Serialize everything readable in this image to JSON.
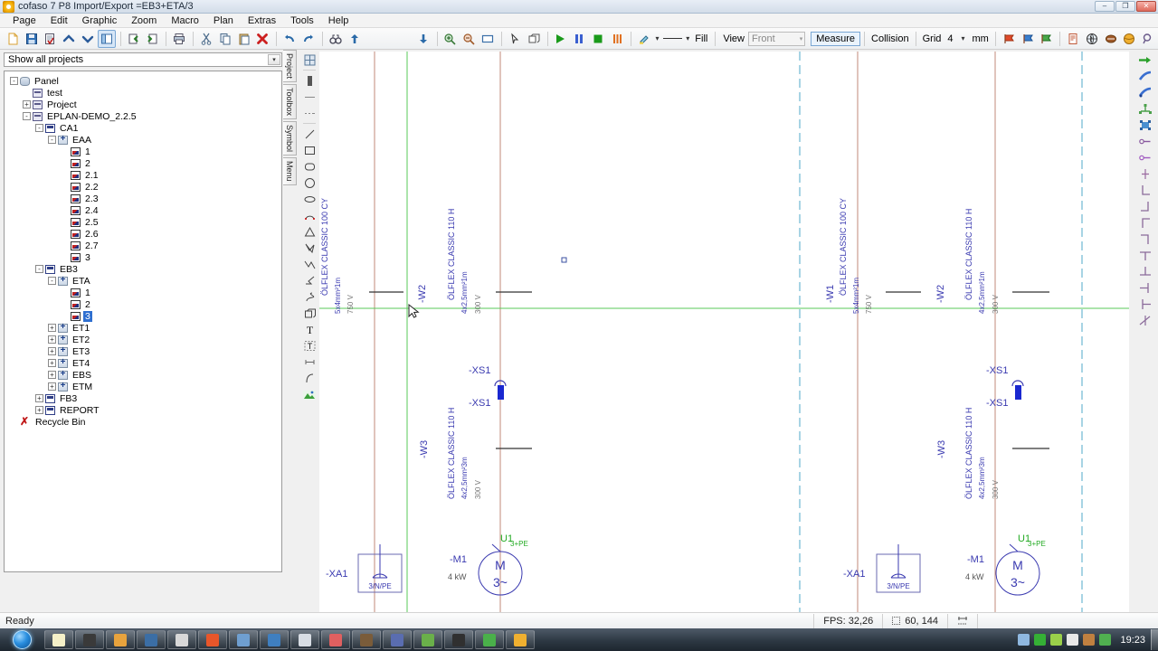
{
  "window": {
    "title": "cofaso 7 P8 Import/Export =EB3+ETA/3",
    "app_icon": "cofaso-icon",
    "minimize": "–",
    "maximize": "❐",
    "close": "✕"
  },
  "menu": {
    "items": [
      "Page",
      "Edit",
      "Graphic",
      "Zoom",
      "Macro",
      "Plan",
      "Extras",
      "Tools",
      "Help"
    ]
  },
  "main_toolbar": {
    "buttons": [
      {
        "name": "new-document-button",
        "icon": "new-page-icon"
      },
      {
        "name": "save-button",
        "icon": "floppy-disk-icon"
      },
      {
        "name": "save-as-button",
        "icon": "document-check-icon"
      },
      {
        "name": "page-up-button",
        "icon": "chevron-up-icon"
      },
      {
        "name": "page-down-button",
        "icon": "chevron-down-icon"
      },
      {
        "name": "toggle-panel-button",
        "icon": "split-panel-icon"
      },
      {
        "name": "import-button",
        "icon": "import-arrow-icon"
      },
      {
        "name": "export-button",
        "icon": "export-arrow-icon"
      },
      {
        "name": "print-button",
        "icon": "printer-icon"
      },
      {
        "name": "cut-button",
        "icon": "scissors-icon"
      },
      {
        "name": "copy-button",
        "icon": "copy-icon"
      },
      {
        "name": "paste-button",
        "icon": "clipboard-paste-icon"
      },
      {
        "name": "delete-button",
        "icon": "red-x-icon"
      },
      {
        "name": "undo-button",
        "icon": "undo-arrow-icon"
      },
      {
        "name": "redo-button",
        "icon": "redo-arrow-icon"
      },
      {
        "name": "find-button",
        "icon": "binoculars-icon"
      },
      {
        "name": "upload-button",
        "icon": "blue-up-arrow-icon"
      }
    ]
  },
  "view_toolbar": {
    "buttons": [
      {
        "name": "down-arrow-button",
        "icon": "blue-down-arrow-icon"
      },
      {
        "name": "zoom-in-button",
        "icon": "magnifier-plus-icon"
      },
      {
        "name": "zoom-out-button",
        "icon": "magnifier-minus-icon"
      },
      {
        "name": "zoom-window-button",
        "icon": "rectangle-icon"
      },
      {
        "name": "select-tool-button",
        "icon": "cursor-arrow-icon"
      },
      {
        "name": "box-tool-button",
        "icon": "cube-icon"
      },
      {
        "name": "play-button",
        "icon": "green-play-icon"
      },
      {
        "name": "pause-button",
        "icon": "blue-pause-icon"
      },
      {
        "name": "stop-button",
        "icon": "green-stop-icon"
      },
      {
        "name": "render-button",
        "icon": "orange-bars-icon"
      },
      {
        "name": "paint-button",
        "icon": "paintbrush-icon"
      },
      {
        "name": "line-style-button",
        "icon": "line-icon"
      }
    ],
    "fill_label": "Fill",
    "view_label": "View",
    "view_value": "Front",
    "measure_label": "Measure",
    "collision_label": "Collision",
    "grid_label": "Grid",
    "grid_value": "4",
    "unit_label": "mm",
    "flag_buttons": [
      {
        "name": "flag-red-button",
        "icon": "red-flag-icon"
      },
      {
        "name": "flag-blue-button",
        "icon": "blue-flag-icon"
      },
      {
        "name": "flag-green-button",
        "icon": "green-flag-icon"
      }
    ],
    "extra_buttons": [
      {
        "name": "report-button",
        "icon": "report-document-icon"
      },
      {
        "name": "globe-button",
        "icon": "globe-icon"
      },
      {
        "name": "ball-button",
        "icon": "brown-ball-icon"
      },
      {
        "name": "sphere-button",
        "icon": "orange-sphere-icon"
      },
      {
        "name": "search-button",
        "icon": "magnifier-icon"
      }
    ]
  },
  "sidebar": {
    "project_filter": "Show all projects",
    "tabs": [
      "Project",
      "Toolbox",
      "Symbol",
      "Menu"
    ],
    "tree": [
      {
        "label": "Panel",
        "indent": 0,
        "expander": "-",
        "icon": "panel-icon",
        "selected": false
      },
      {
        "label": "test",
        "indent": 1,
        "expander": "",
        "icon": "book-icon",
        "selected": false
      },
      {
        "label": "Project",
        "indent": 1,
        "expander": "+",
        "icon": "book-icon",
        "selected": false
      },
      {
        "label": "EPLAN-DEMO_2.2.5",
        "indent": 1,
        "expander": "-",
        "icon": "book-icon",
        "selected": false
      },
      {
        "label": "CA1",
        "indent": 2,
        "expander": "-",
        "icon": "page-icon",
        "selected": false
      },
      {
        "label": "EAA",
        "indent": 3,
        "expander": "-",
        "icon": "plus-icon",
        "selected": false
      },
      {
        "label": "1",
        "indent": 4,
        "expander": "",
        "icon": "sheet-icon",
        "selected": false
      },
      {
        "label": "2",
        "indent": 4,
        "expander": "",
        "icon": "sheet-icon",
        "selected": false
      },
      {
        "label": "2.1",
        "indent": 4,
        "expander": "",
        "icon": "sheet-icon",
        "selected": false
      },
      {
        "label": "2.2",
        "indent": 4,
        "expander": "",
        "icon": "sheet-icon",
        "selected": false
      },
      {
        "label": "2.3",
        "indent": 4,
        "expander": "",
        "icon": "sheet-icon",
        "selected": false
      },
      {
        "label": "2.4",
        "indent": 4,
        "expander": "",
        "icon": "sheet-icon",
        "selected": false
      },
      {
        "label": "2.5",
        "indent": 4,
        "expander": "",
        "icon": "sheet-icon",
        "selected": false
      },
      {
        "label": "2.6",
        "indent": 4,
        "expander": "",
        "icon": "sheet-icon",
        "selected": false
      },
      {
        "label": "2.7",
        "indent": 4,
        "expander": "",
        "icon": "sheet-icon",
        "selected": false
      },
      {
        "label": "3",
        "indent": 4,
        "expander": "",
        "icon": "sheet-icon",
        "selected": false
      },
      {
        "label": "EB3",
        "indent": 2,
        "expander": "-",
        "icon": "page-icon",
        "selected": false
      },
      {
        "label": "ETA",
        "indent": 3,
        "expander": "-",
        "icon": "plus-icon",
        "selected": false
      },
      {
        "label": "1",
        "indent": 4,
        "expander": "",
        "icon": "sheet-icon",
        "selected": false
      },
      {
        "label": "2",
        "indent": 4,
        "expander": "",
        "icon": "sheet-icon",
        "selected": false
      },
      {
        "label": "3",
        "indent": 4,
        "expander": "",
        "icon": "sheet-icon",
        "selected": true
      },
      {
        "label": "ET1",
        "indent": 3,
        "expander": "+",
        "icon": "plus-icon",
        "selected": false
      },
      {
        "label": "ET2",
        "indent": 3,
        "expander": "+",
        "icon": "plus-icon",
        "selected": false
      },
      {
        "label": "ET3",
        "indent": 3,
        "expander": "+",
        "icon": "plus-icon",
        "selected": false
      },
      {
        "label": "ET4",
        "indent": 3,
        "expander": "+",
        "icon": "plus-icon",
        "selected": false
      },
      {
        "label": "EBS",
        "indent": 3,
        "expander": "+",
        "icon": "plus-icon",
        "selected": false
      },
      {
        "label": "ETM",
        "indent": 3,
        "expander": "+",
        "icon": "plus-icon",
        "selected": false
      },
      {
        "label": "FB3",
        "indent": 2,
        "expander": "+",
        "icon": "page-icon",
        "selected": false
      },
      {
        "label": "REPORT",
        "indent": 2,
        "expander": "+",
        "icon": "page-icon",
        "selected": false
      },
      {
        "label": "Recycle Bin",
        "indent": 0,
        "expander": "",
        "icon": "recycle-icon",
        "selected": false
      }
    ]
  },
  "draw_toolbar": {
    "tools": [
      {
        "name": "grid-tool",
        "icon": "grid-icon"
      },
      {
        "name": "fill-tool",
        "icon": "filled-bar-icon"
      },
      {
        "name": "hline-tool",
        "icon": "horizontal-line-icon"
      },
      {
        "name": "dashline-tool",
        "icon": "dashed-line-icon"
      },
      {
        "name": "line-tool",
        "icon": "diagonal-line-icon"
      },
      {
        "name": "rect-tool",
        "icon": "rectangle-icon"
      },
      {
        "name": "roundrect-tool",
        "icon": "rounded-rectangle-icon"
      },
      {
        "name": "circle-tool",
        "icon": "circle-icon"
      },
      {
        "name": "ellipse-tool",
        "icon": "ellipse-icon"
      },
      {
        "name": "arc-tool",
        "icon": "arc-icon"
      },
      {
        "name": "triangle-tool",
        "icon": "triangle-icon"
      },
      {
        "name": "polygon-tool",
        "icon": "polygon-icon"
      },
      {
        "name": "polyline-tool",
        "icon": "polyline-icon"
      },
      {
        "name": "bend-tool",
        "icon": "bend-icon"
      },
      {
        "name": "spline-tool",
        "icon": "spline-icon"
      },
      {
        "name": "cube-tool",
        "icon": "cube-icon"
      },
      {
        "name": "text-tool",
        "icon": "text-t-icon"
      },
      {
        "name": "text-box-tool",
        "icon": "text-box-icon"
      },
      {
        "name": "dimension-tool",
        "icon": "dimension-icon"
      },
      {
        "name": "curve-tool",
        "icon": "curve-icon"
      },
      {
        "name": "image-tool",
        "icon": "image-icon"
      }
    ]
  },
  "right_toolbar": {
    "tools": [
      {
        "name": "connect-right-tool",
        "icon": "green-arrow-right-icon"
      },
      {
        "name": "wire-tool",
        "icon": "blue-wire-icon"
      },
      {
        "name": "wire-alt-tool",
        "icon": "blue-wire-alt-icon"
      },
      {
        "name": "bus-tool",
        "icon": "green-bus-icon"
      },
      {
        "name": "block-tool",
        "icon": "blue-block-icon"
      },
      {
        "name": "terminal-tool",
        "icon": "terminal-dot-icon"
      },
      {
        "name": "terminal-alt-tool",
        "icon": "terminal-dot-purple-icon"
      },
      {
        "name": "tjoint-tool",
        "icon": "t-joint-icon"
      },
      {
        "name": "corner-bl-tool",
        "icon": "corner-bottom-left-icon"
      },
      {
        "name": "corner-br-tool",
        "icon": "corner-bottom-right-icon"
      },
      {
        "name": "corner-tl-tool",
        "icon": "corner-top-left-icon"
      },
      {
        "name": "corner-tr-tool",
        "icon": "corner-top-right-icon"
      },
      {
        "name": "tee-down-tool",
        "icon": "tee-down-icon"
      },
      {
        "name": "tee-up-tool",
        "icon": "tee-up-icon"
      },
      {
        "name": "tee-left-tool",
        "icon": "tee-left-icon"
      },
      {
        "name": "tee-right-tool",
        "icon": "tee-right-icon"
      },
      {
        "name": "cross-tool",
        "icon": "cross-junction-icon"
      }
    ]
  },
  "schematic": {
    "left_group": {
      "cables": [
        {
          "id": "",
          "type": "ÖLFLEX CLASSIC 100 CY",
          "spec": "5x4mm²1m",
          "volt": "750 V"
        },
        {
          "id": "-W2",
          "type": "ÖLFLEX CLASSIC 110 H",
          "spec": "4x2,5mm²1m",
          "volt": "300 V"
        },
        {
          "id": "-W3",
          "type": "ÖLFLEX CLASSIC 110 H",
          "spec": "4x2,5mm²3m",
          "volt": "300 V"
        }
      ],
      "terminal_top": "-XS1",
      "terminal_bottom": "-XS1",
      "panel_tag": "-XA1",
      "panel_text": "3/N/PE",
      "motor_tag": "-M1",
      "motor_power": "4 kW",
      "motor_symbol": "M",
      "motor_phase": "3~",
      "motor_conn": "U1",
      "motor_conn_sub": "3+PE"
    },
    "right_group": {
      "cables": [
        {
          "id": "-W1",
          "type": "ÖLFLEX CLASSIC 100 CY",
          "spec": "5x4mm²1m",
          "volt": "750 V"
        },
        {
          "id": "-W2",
          "type": "ÖLFLEX CLASSIC 110 H",
          "spec": "4x2,5mm²1m",
          "volt": "300 V"
        },
        {
          "id": "-W3",
          "type": "ÖLFLEX CLASSIC 110 H",
          "spec": "4x2,5mm²3m",
          "volt": "300 V"
        }
      ],
      "terminal_top": "-XS1",
      "terminal_bottom": "-XS1",
      "panel_tag": "-XA1",
      "panel_text": "3/N/PE",
      "motor_tag": "-M1",
      "motor_power": "4 kW",
      "motor_symbol": "M",
      "motor_phase": "3~",
      "motor_conn": "U1",
      "motor_conn_sub": "3+PE"
    }
  },
  "statusbar": {
    "ready": "Ready",
    "fps": "FPS: 32,26",
    "coords": "60, 144",
    "dim_icon": "dimension-icon"
  },
  "taskbar": {
    "start": "start-orb",
    "items": [
      {
        "name": "taskbar-item-1",
        "color": "#f5f0c8"
      },
      {
        "name": "taskbar-item-2",
        "color": "#3a3a3a"
      },
      {
        "name": "taskbar-item-3",
        "color": "#e8a33d"
      },
      {
        "name": "taskbar-item-4",
        "color": "#3b6ea5"
      },
      {
        "name": "taskbar-item-5",
        "color": "#d8d8d8"
      },
      {
        "name": "taskbar-item-6",
        "color": "#e8562a"
      },
      {
        "name": "taskbar-item-7",
        "color": "#6f9fd0"
      },
      {
        "name": "taskbar-item-8",
        "color": "#3f7fc0"
      },
      {
        "name": "taskbar-item-9",
        "color": "#d8dde4"
      },
      {
        "name": "taskbar-item-10",
        "color": "#e06060"
      },
      {
        "name": "taskbar-item-11",
        "color": "#7a5c3a"
      },
      {
        "name": "taskbar-item-12",
        "color": "#5a6db0"
      },
      {
        "name": "taskbar-item-13",
        "color": "#6ab04a"
      },
      {
        "name": "taskbar-item-14",
        "color": "#303030"
      },
      {
        "name": "taskbar-item-15",
        "color": "#4ab04a"
      },
      {
        "name": "taskbar-item-16",
        "color": "#f0b030"
      }
    ],
    "tray": [
      {
        "name": "tray-network-icon",
        "color": "#8fb8e0"
      },
      {
        "name": "tray-monitor-icon",
        "color": "#35b035"
      },
      {
        "name": "tray-shield-icon",
        "color": "#9ad04a"
      },
      {
        "name": "tray-folder-icon",
        "color": "#e8e8e8"
      },
      {
        "name": "tray-volume-icon",
        "color": "#c08040"
      },
      {
        "name": "tray-update-icon",
        "color": "#50b050"
      }
    ],
    "clock": "19:23"
  }
}
